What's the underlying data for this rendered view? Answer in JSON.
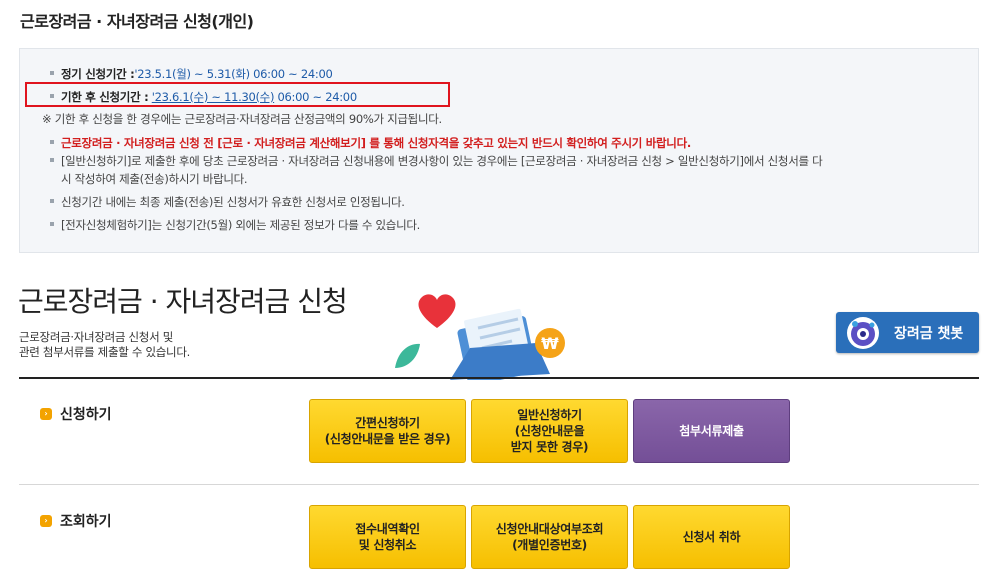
{
  "page_title": "근로장려금 · 자녀장려금 신청(개인)",
  "notice": {
    "regular_label": "정기 신청기간 :",
    "regular_value": "'23.5.1(월) ~ 5.31(화) 06:00 ~ 24:00",
    "late_label": "기한 후 신청기간 :",
    "late_value_link": "'23.6.1(수) ~ 11.30(수)",
    "late_value_time": "06:00 ~ 24:00",
    "late_note": "※ 기한 후 신청을 한 경우에는 근로장려금·자녀장려금 산정금액의 90%가 지급됩니다.",
    "red_warning": "근로장려금 · 자녀장려금 신청 전 [근로 · 자녀장려금 계산해보기] 를 통해 신청자격을 갖추고 있는지 반드시 확인하여 주시기 바랍니다.",
    "line_general_1": "[일반신청하기]로 제출한 후에 당초 근로장려금 · 자녀장려금 신청내용에 변경사항이 있는 경우에는 [근로장려금 · 자녀장려금 신청 > 일반신청하기]에서 신청서를 다",
    "line_general_2": "시 작성하여 제출(전송)하시기 바랍니다.",
    "line_valid": "신청기간 내에는 최종 제출(전송)된 신청서가 유효한 신청서로 인정됩니다.",
    "line_trial": "[전자신청체험하기]는 신청기간(5월) 외에는 제공된 정보가 다를 수 있습니다."
  },
  "section": {
    "title": "근로장려금 · 자녀장려금 신청",
    "desc_1": "근로장려금·자녀장려금 신청서 및",
    "desc_2": "관련 첨부서류를 제출할 수 있습니다."
  },
  "chatbot": {
    "label": "장려금 챗봇",
    "icon": "robot-icon"
  },
  "apply_row": {
    "label": "신청하기",
    "buttons": [
      {
        "line1": "간편신청하기",
        "line2": "(신청안내문을 받은 경우)",
        "line3": ""
      },
      {
        "line1": "일반신청하기",
        "line2": "(신청안내문을",
        "line3": "받지 못한 경우)"
      },
      {
        "line1": "첨부서류제출",
        "line2": "",
        "line3": ""
      }
    ]
  },
  "inquiry_row": {
    "label": "조회하기",
    "buttons": [
      {
        "line1": "접수내역확인",
        "line2": "및 신청취소"
      },
      {
        "line1": "신청안내대상여부조회",
        "line2": "(개별인증번호)"
      },
      {
        "line1": "신청서 취하",
        "line2": ""
      }
    ]
  },
  "colors": {
    "accent_blue": "#2a6fba",
    "button_yellow": "#f6bf00",
    "button_purple": "#744f97",
    "warning_red": "#d21e1e",
    "highlight_border": "#e0141e"
  }
}
